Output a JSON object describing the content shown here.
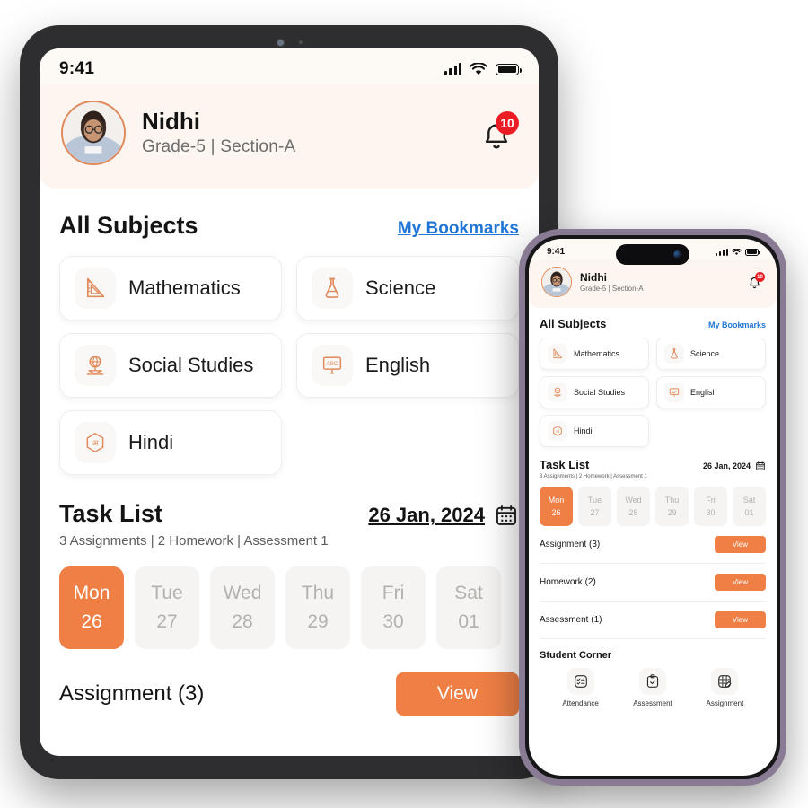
{
  "tablet": {
    "status_bar": {
      "time": "9:41",
      "signal_icon": "cellular-bars-icon",
      "wifi_icon": "wifi-icon",
      "battery_icon": "battery-icon"
    },
    "header": {
      "avatar": "student-avatar",
      "name": "Nidhi",
      "meta": "Grade-5 | Section-A",
      "bell_icon": "notification-bell-icon",
      "badge_count": "10"
    },
    "subjects_section": {
      "title": "All Subjects",
      "bookmarks_link": "My Bookmarks",
      "items": [
        {
          "label": "Mathematics",
          "icon": "set-square-ruler-icon"
        },
        {
          "label": "Science",
          "icon": "flask-icon"
        },
        {
          "label": "Social Studies",
          "icon": "globe-book-icon"
        },
        {
          "label": "English",
          "icon": "abc-board-icon"
        },
        {
          "label": "Hindi",
          "icon": "hindi-letter-hexagon-icon"
        }
      ]
    },
    "task_list": {
      "title": "Task List",
      "subtitle": "3 Assignments | 2 Homework | Assessment 1",
      "date": "26 Jan, 2024",
      "calendar_icon": "calendar-icon",
      "days": [
        {
          "day": "Mon",
          "num": "26",
          "active": true
        },
        {
          "day": "Tue",
          "num": "27",
          "active": false
        },
        {
          "day": "Wed",
          "num": "28",
          "active": false
        },
        {
          "day": "Thu",
          "num": "29",
          "active": false
        },
        {
          "day": "Fri",
          "num": "30",
          "active": false
        },
        {
          "day": "Sat",
          "num": "01",
          "active": false
        }
      ],
      "rows": [
        {
          "name": "Assignment (3)",
          "action": "View"
        }
      ]
    }
  },
  "phone": {
    "status_bar": {
      "time": "9:41",
      "signal_icon": "cellular-bars-icon",
      "wifi_icon": "wifi-icon",
      "battery_icon": "battery-icon"
    },
    "header": {
      "avatar": "student-avatar",
      "name": "Nidhi",
      "meta": "Grade-5 | Section-A",
      "bell_icon": "notification-bell-icon",
      "badge_count": "10"
    },
    "subjects_section": {
      "title": "All Subjects",
      "bookmarks_link": "My Bookmarks",
      "items": [
        {
          "label": "Mathematics",
          "icon": "set-square-ruler-icon"
        },
        {
          "label": "Science",
          "icon": "flask-icon"
        },
        {
          "label": "Social Studies",
          "icon": "globe-book-icon"
        },
        {
          "label": "English",
          "icon": "abc-board-icon"
        },
        {
          "label": "Hindi",
          "icon": "hindi-letter-hexagon-icon"
        }
      ]
    },
    "task_list": {
      "title": "Task List",
      "subtitle": "3 Assignments | 2 Homework | Assessment 1",
      "date": "26 Jan, 2024",
      "calendar_icon": "calendar-icon",
      "days": [
        {
          "day": "Mon",
          "num": "26",
          "active": true
        },
        {
          "day": "Tue",
          "num": "27",
          "active": false
        },
        {
          "day": "Wed",
          "num": "28",
          "active": false
        },
        {
          "day": "Thu",
          "num": "29",
          "active": false
        },
        {
          "day": "Fri",
          "num": "30",
          "active": false
        },
        {
          "day": "Sat",
          "num": "01",
          "active": false
        }
      ],
      "rows": [
        {
          "name": "Assignment (3)",
          "action": "View"
        },
        {
          "name": "Homework (2)",
          "action": "View"
        },
        {
          "name": "Assessment (1)",
          "action": "View"
        }
      ]
    },
    "student_corner": {
      "title": "Student Corner",
      "items": [
        {
          "label": "Attendance",
          "icon": "checklist-icon"
        },
        {
          "label": "Assessment",
          "icon": "clipboard-check-icon"
        },
        {
          "label": "Assignment",
          "icon": "grid-pencil-icon"
        }
      ]
    }
  },
  "theme": {
    "accent": "#ef7f45",
    "badge_red": "#ec1c24",
    "link_blue": "#1f76d6",
    "header_cream": "#fdf6f0",
    "phone_frame": "#8a7b95"
  }
}
